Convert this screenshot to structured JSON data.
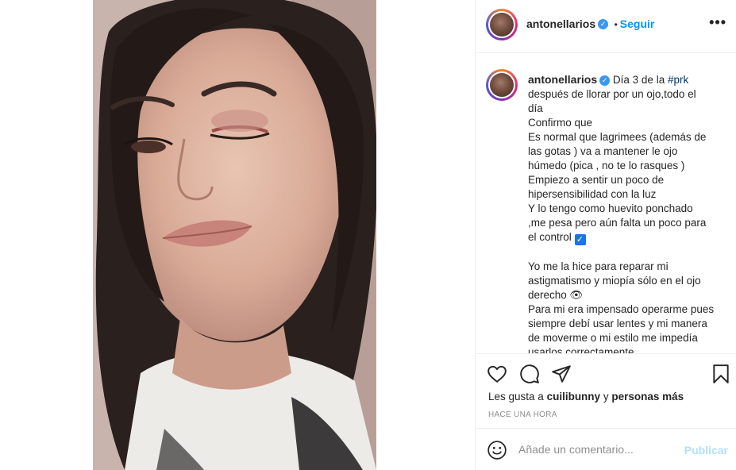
{
  "post": {
    "author": "antonellarios",
    "follow_label": "Seguir",
    "separator": "•",
    "more_label": "•••"
  },
  "caption": {
    "author": "antonellarios",
    "intro": "Día 3 de la ",
    "hashtag": "#prk",
    "lines": [
      "después de llorar por un ojo,todo el",
      "día",
      "Confirmo que",
      "Es normal que lagrimees (además de",
      "las gotas ) va a mantener le ojo",
      "húmedo (pica , no te lo rasques )",
      "Empiezo a sentir un poco de",
      "hipersensibilidad con la luz",
      "Y lo tengo como huevito ponchado",
      ",me pesa pero aún falta un poco para",
      "el control ",
      "",
      "Yo me la hice para reparar mi",
      "astigmatismo y miopía sólo en el ojo",
      "derecho 👁",
      "Para mi era impensado operarme pues",
      "siempre debí usar lentes y mi manera",
      "de moverme o mi estilo me impedía",
      "usarlos correctamente"
    ],
    "checkbox_glyph": "✓"
  },
  "likes": {
    "prefix": "Les gusta a ",
    "user": "cuilibunny",
    "connector": " y ",
    "others": "personas más"
  },
  "time_ago": "HACE UNA HORA",
  "comment": {
    "placeholder": "Añade un comentario...",
    "publish_label": "Publicar"
  },
  "colors": {
    "link_blue": "#0095f6",
    "publish_disabled": "#b2dffc",
    "verified_blue": "#3897f0",
    "hashtag": "#00376b"
  },
  "icons": {
    "header": [
      "verified-badge-icon",
      "more-options-icon"
    ],
    "actions": [
      "heart-icon",
      "comment-bubble-icon",
      "share-paper-plane-icon",
      "bookmark-icon"
    ],
    "comment": [
      "emoji-smiley-icon"
    ]
  }
}
